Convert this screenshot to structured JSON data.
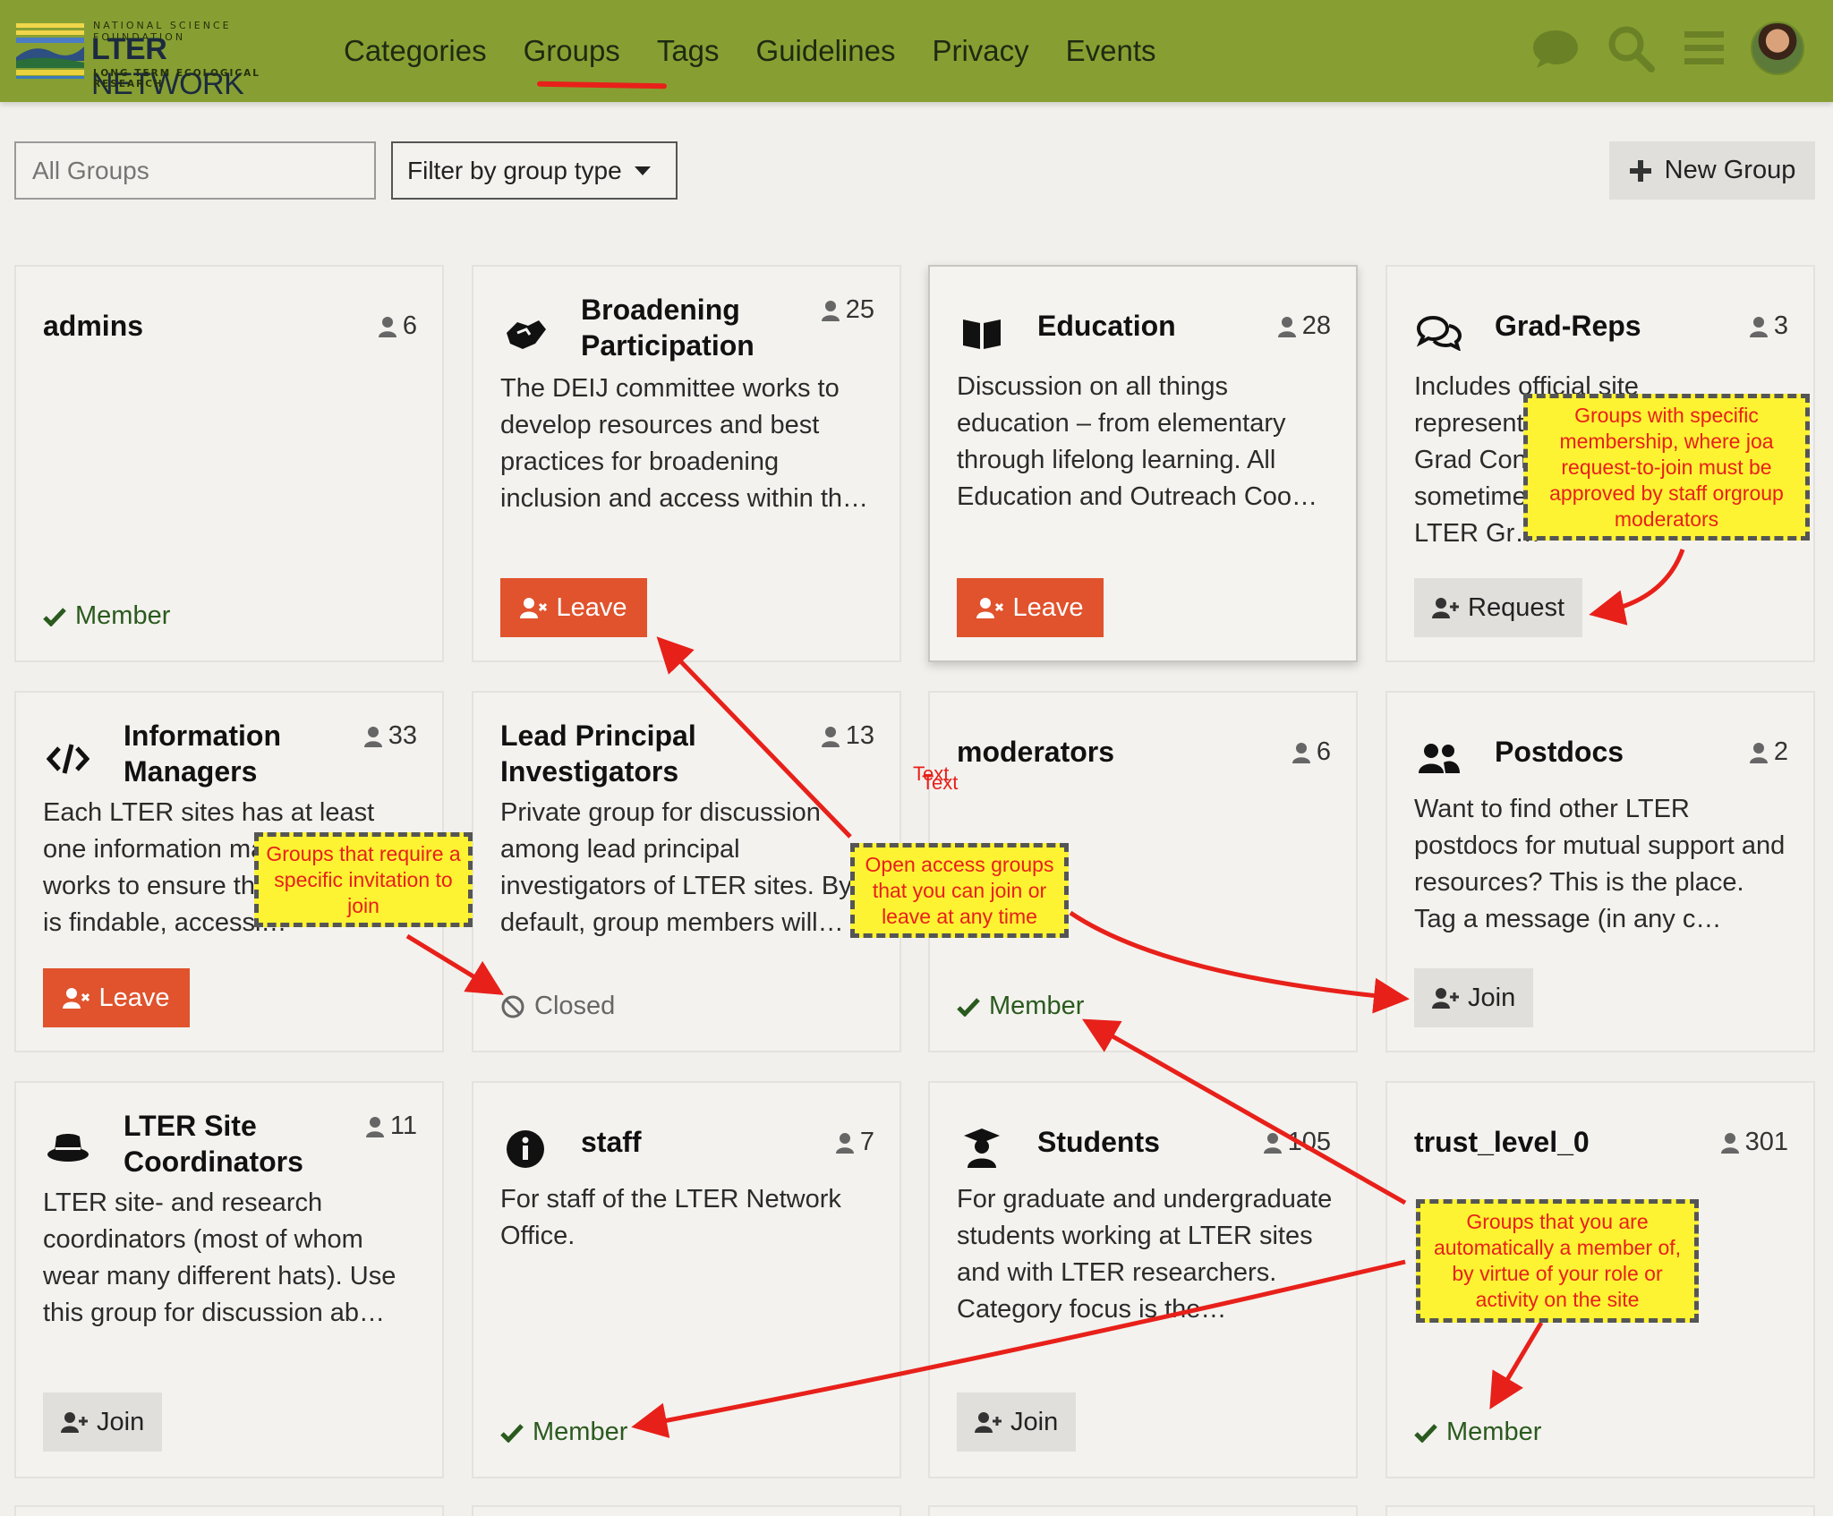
{
  "header": {
    "logo": {
      "top_text": "NATIONAL SCIENCE FOUNDATION",
      "main_bold": "LTER",
      "main_light": "NETWORK",
      "bottom_text": "LONG TERM ECOLOGICAL RESEARCH"
    },
    "nav": [
      "Categories",
      "Groups",
      "Tags",
      "Guidelines",
      "Privacy",
      "Events"
    ],
    "active_nav": "Groups",
    "icons": [
      "chat-icon",
      "search-icon",
      "hamburger-menu-icon",
      "user-avatar"
    ]
  },
  "controls": {
    "search_placeholder": "All Groups",
    "filter_label": "Filter by group type",
    "new_group_label": "New Group"
  },
  "cards": [
    {
      "title": "admins",
      "count": "6",
      "desc": "",
      "action": "Member"
    },
    {
      "title": "Broadening Participation",
      "count": "25",
      "desc": "The DEIJ committee works to develop resources and best practices for broadening inclusion and access within th…",
      "action": "Leave",
      "icon": "handshake-icon"
    },
    {
      "title": "Education",
      "count": "28",
      "desc": "Discussion on all things education – from elementary through lifelong learning. All Education and Outreach Coo…",
      "action": "Leave",
      "icon": "book-icon"
    },
    {
      "title": "Grad-Reps",
      "count": "3",
      "desc_visible": [
        "Includes official site",
        "represent",
        "Grad Con",
        "sometime",
        "LTER Gr…"
      ],
      "action": "Request",
      "icon": "comments-icon"
    },
    {
      "title": "Information Managers",
      "count": "33",
      "desc_visible": [
        "Each LTER sites has at least",
        "one information ma",
        "works to ensure th",
        "is findable, accessi…"
      ],
      "action": "Leave",
      "icon": "code-icon"
    },
    {
      "title": "Lead Principal Investigators",
      "count": "13",
      "desc": "Private group for discussion among lead principal investigators of LTER sites. By default, group members will…",
      "action": "Closed"
    },
    {
      "title": "moderators",
      "count": "6",
      "desc": "",
      "action": "Member"
    },
    {
      "title": "Postdocs",
      "count": "2",
      "desc": "Want to find other LTER postdocs for mutual support and resources? This is the place. Tag a message (in any c…",
      "action": "Join",
      "icon": "users-icon"
    },
    {
      "title": "LTER Site Coordinators",
      "count": "11",
      "desc": "LTER site- and research coordinators (most of whom wear many different hats). Use this group for discussion ab…",
      "action": "Join",
      "icon": "hat-icon"
    },
    {
      "title": "staff",
      "count": "7",
      "desc": "For staff of the LTER Network Office.",
      "action": "Member",
      "icon": "info-icon"
    },
    {
      "title": "Students",
      "count": "105",
      "desc": "For graduate and undergraduate students working at LTER sites and with LTER researchers. Category focus is the…",
      "action": "Join",
      "icon": "graduate-icon"
    },
    {
      "title": "trust_level_0",
      "count": "301",
      "desc": "",
      "action": "Member"
    }
  ],
  "callouts": {
    "request": "Groups with specific membership, where joa request-to-join must be approved by staff orgroup moderators",
    "invitation": "Groups that require a specific invitation to join",
    "open": "Open access groups that you can join or leave at any time",
    "automatic": "Groups that you are automatically a member of, by virtue of your role or activity on the site"
  },
  "stray_text": [
    "Text",
    "Text"
  ],
  "colors": {
    "header_bg": "#879f32",
    "leave_button": "#e0532d",
    "member_text": "#2a5a1e",
    "callout_bg": "#fdf332",
    "annotation_red": "#e8201a"
  }
}
